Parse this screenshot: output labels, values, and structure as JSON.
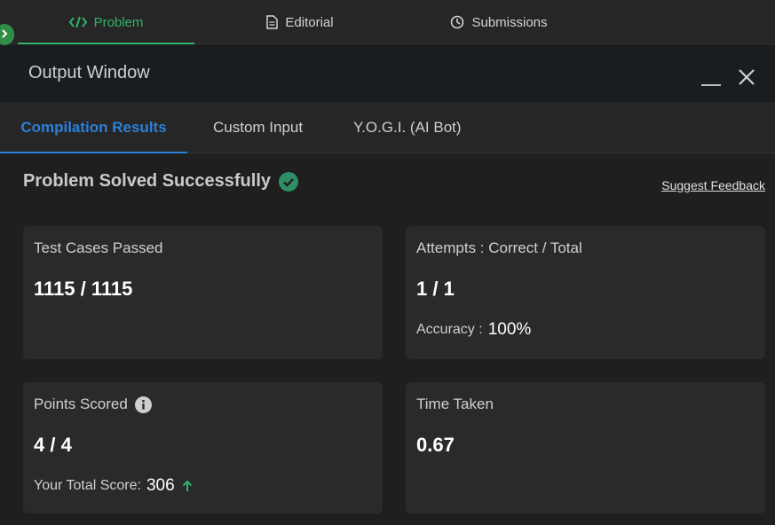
{
  "top_tabs": [
    {
      "label": "Problem",
      "icon": "code-icon",
      "active": true
    },
    {
      "label": "Editorial",
      "icon": "document-icon",
      "active": false
    },
    {
      "label": "Submissions",
      "icon": "clock-icon",
      "active": false
    }
  ],
  "output_window": {
    "title": "Output Window"
  },
  "result_tabs": [
    {
      "label": "Compilation Results",
      "active": true
    },
    {
      "label": "Custom Input",
      "active": false
    },
    {
      "label": "Y.O.G.I. (AI Bot)",
      "active": false
    }
  ],
  "result": {
    "status": "Problem Solved Successfully",
    "feedback_link": "Suggest Feedback"
  },
  "cards": {
    "test_cases": {
      "label": "Test Cases Passed",
      "value": "1115 / 1115"
    },
    "attempts": {
      "label": "Attempts : Correct / Total",
      "value": "1 / 1",
      "sub_label": "Accuracy :",
      "sub_value": "100%"
    },
    "points": {
      "label": "Points Scored",
      "value": "4 / 4",
      "sub_label": "Your Total Score:",
      "sub_value": "306"
    },
    "time": {
      "label": "Time Taken",
      "value": "0.67"
    }
  },
  "colors": {
    "accent_green": "#2fb36a",
    "accent_blue": "#2d7fd6",
    "card_bg": "#2a2a2a",
    "success_check": "#2e8f67"
  }
}
